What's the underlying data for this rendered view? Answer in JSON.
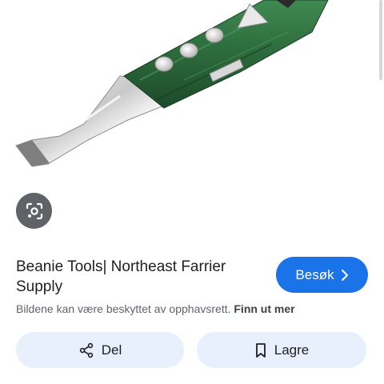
{
  "result": {
    "title": "Beanie Tools| Northeast Farrier Supply",
    "visit_label": "Besøk",
    "copyright_notice": "Bildene kan være beskyttet av opphavsrett.",
    "learn_more_label": "Finn ut mer"
  },
  "actions": {
    "share_label": "Del",
    "save_label": "Lagre"
  },
  "icons": {
    "lens": "lens-search-icon",
    "visit": "chevron-right-icon",
    "share": "share-icon",
    "save": "bookmark-icon"
  },
  "colors": {
    "accent": "#1a73e8",
    "pill_background": "#e8f0fe",
    "lens_background": "#5f6368",
    "handle_green": "#2e6b3e"
  }
}
